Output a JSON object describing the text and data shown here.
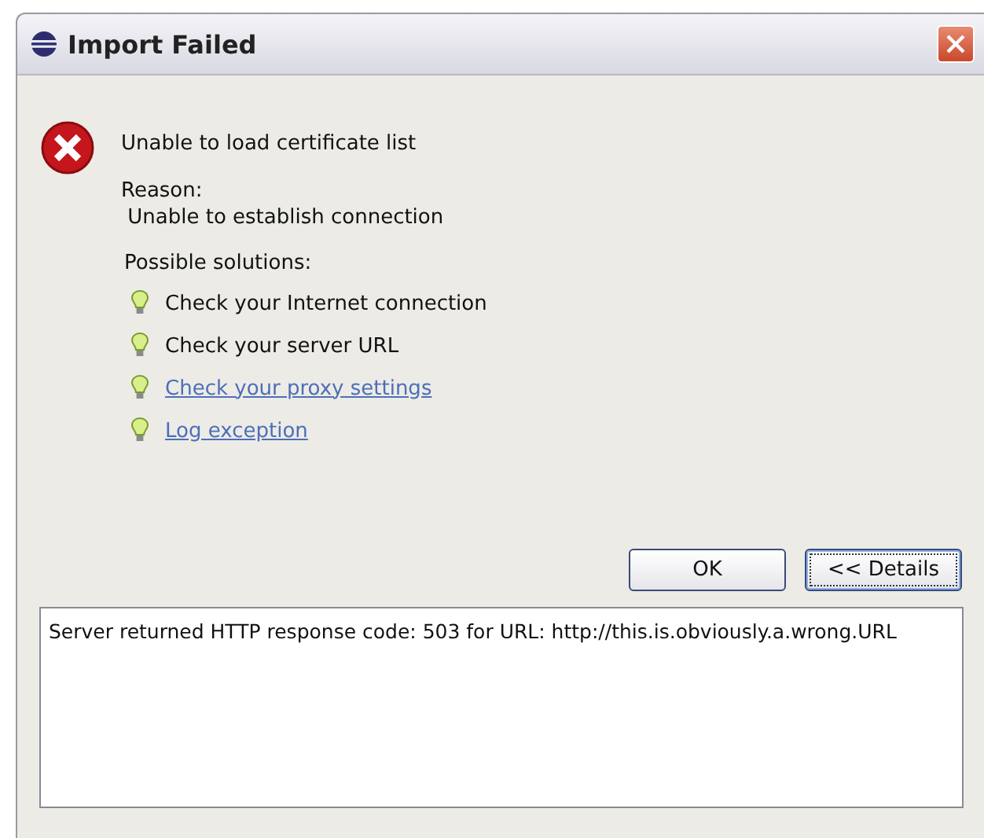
{
  "window": {
    "title": "Import Failed"
  },
  "message": "Unable to load certificate list",
  "reason_label": "Reason:",
  "reason": " Unable to establish connection",
  "solutions_label": "Possible solutions:",
  "solutions": [
    {
      "text": "Check your Internet connection",
      "kind": "text"
    },
    {
      "text": "Check your server URL",
      "kind": "text"
    },
    {
      "text": "Check your proxy settings",
      "kind": "link"
    },
    {
      "text": "Log exception",
      "kind": "link"
    }
  ],
  "buttons": [
    {
      "label": "OK",
      "focused": false
    },
    {
      "label": "<< Details",
      "focused": true
    }
  ],
  "details": "Server returned HTTP response code: 503 for URL: http://this.is.obviously.a.wrong.URL"
}
